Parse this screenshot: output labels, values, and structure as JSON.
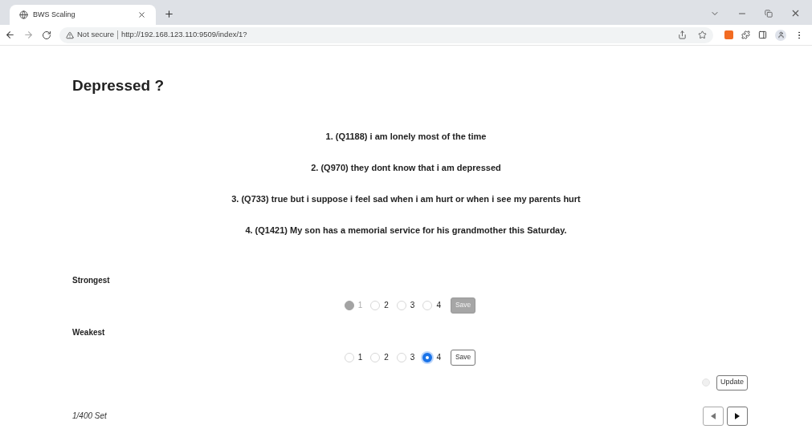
{
  "browser": {
    "tab_title": "BWS Scaling",
    "security": "Not secure",
    "url": "http://192.168.123.110:9509/index/1?"
  },
  "title": "Depressed ?",
  "questions": [
    "1. (Q1188) i am lonely most of the time",
    "2. (Q970) they dont know that i am depressed",
    "3. (Q733) true but i suppose i feel sad when i am hurt or when i see my parents hurt",
    "4. (Q1421) My son has a memorial service for his grandmother this Saturday."
  ],
  "groups": [
    {
      "label": "Strongest",
      "disabled": true,
      "options": [
        {
          "label": "1",
          "selected": true
        },
        {
          "label": "2",
          "selected": false
        },
        {
          "label": "3",
          "selected": false
        },
        {
          "label": "4",
          "selected": false
        }
      ],
      "save": {
        "label": "Save",
        "disabled": true
      }
    },
    {
      "label": "Weakest",
      "disabled": false,
      "options": [
        {
          "label": "1",
          "selected": false
        },
        {
          "label": "2",
          "selected": false
        },
        {
          "label": "3",
          "selected": false
        },
        {
          "label": "4",
          "selected": true
        }
      ],
      "save": {
        "label": "Save",
        "disabled": false
      }
    }
  ],
  "update": {
    "checked": false,
    "label": "Update"
  },
  "footer": {
    "set_count": "1/400 Set",
    "prev": {
      "disabled": true
    },
    "next": {
      "disabled": false
    }
  }
}
